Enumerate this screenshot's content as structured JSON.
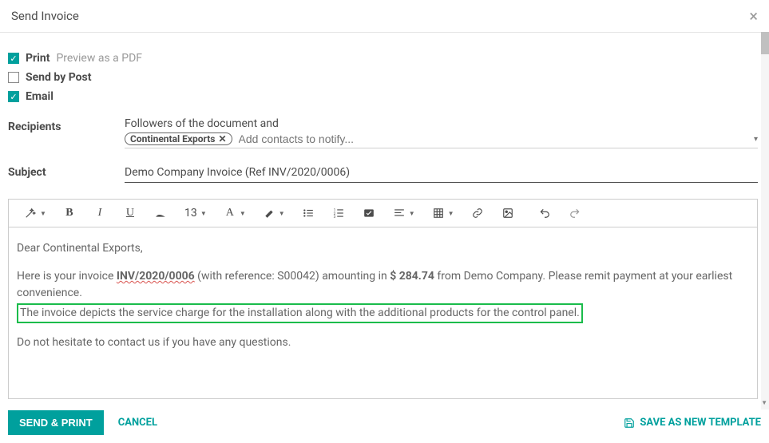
{
  "header": {
    "title": "Send Invoice"
  },
  "options": {
    "print": {
      "label": "Print",
      "hint": "Preview as a PDF",
      "checked": true
    },
    "post": {
      "label": "Send by Post",
      "checked": false
    },
    "email": {
      "label": "Email",
      "checked": true
    }
  },
  "recipients": {
    "label": "Recipients",
    "followers_text": "Followers of the document and",
    "tags": [
      "Continental Exports"
    ],
    "placeholder": "Add contacts to notify..."
  },
  "subject": {
    "label": "Subject",
    "value": "Demo Company Invoice (Ref INV/2020/0006)"
  },
  "toolbar": {
    "font_size": "13"
  },
  "body": {
    "greeting": "Dear Continental Exports,",
    "line2_pre": "Here is your invoice ",
    "line2_inv": "INV/2020/0006",
    "line2_mid": " (with reference: S00042) amounting in ",
    "line2_amt": "$ 284.74",
    "line2_post": " from Demo Company. Please remit payment at your earliest convenience.",
    "highlighted": "The invoice depicts the service charge for the installation along with the additional products for the control panel.",
    "closing": "Do not hesitate to contact us if you have any questions."
  },
  "footer": {
    "send": "SEND & PRINT",
    "cancel": "CANCEL",
    "save_template": "SAVE AS NEW TEMPLATE"
  }
}
